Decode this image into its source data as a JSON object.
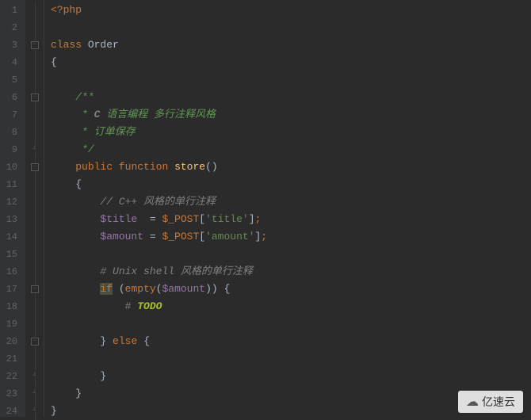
{
  "lines": [
    {
      "n": 1,
      "tokens": [
        {
          "t": "<?php",
          "c": "k-php"
        }
      ]
    },
    {
      "n": 2,
      "tokens": []
    },
    {
      "n": 3,
      "tokens": [
        {
          "t": "class",
          "c": "k-class"
        },
        {
          "t": " ",
          "c": ""
        },
        {
          "t": "Order",
          "c": "classname"
        }
      ]
    },
    {
      "n": 4,
      "tokens": [
        {
          "t": "{",
          "c": "brace"
        }
      ]
    },
    {
      "n": 5,
      "tokens": []
    },
    {
      "n": 6,
      "tokens": [
        {
          "t": "    ",
          "c": ""
        },
        {
          "t": "/**",
          "c": "doc-comment"
        }
      ]
    },
    {
      "n": 7,
      "tokens": [
        {
          "t": "     ",
          "c": ""
        },
        {
          "t": "* ",
          "c": "doc-comment"
        },
        {
          "t": "C",
          "c": "comment-bold"
        },
        {
          "t": " 语言编程 多行注释风格",
          "c": "doc-comment"
        }
      ]
    },
    {
      "n": 8,
      "tokens": [
        {
          "t": "     ",
          "c": ""
        },
        {
          "t": "* 订单保存",
          "c": "doc-comment"
        }
      ]
    },
    {
      "n": 9,
      "tokens": [
        {
          "t": "     ",
          "c": ""
        },
        {
          "t": "*/",
          "c": "doc-comment"
        }
      ]
    },
    {
      "n": 10,
      "tokens": [
        {
          "t": "    ",
          "c": ""
        },
        {
          "t": "public",
          "c": "k-public"
        },
        {
          "t": " ",
          "c": ""
        },
        {
          "t": "function",
          "c": "k-function"
        },
        {
          "t": " ",
          "c": ""
        },
        {
          "t": "store",
          "c": "funcname"
        },
        {
          "t": "()",
          "c": "paren"
        }
      ]
    },
    {
      "n": 11,
      "tokens": [
        {
          "t": "    ",
          "c": ""
        },
        {
          "t": "{",
          "c": "brace"
        }
      ]
    },
    {
      "n": 12,
      "tokens": [
        {
          "t": "        ",
          "c": ""
        },
        {
          "t": "// ",
          "c": "comment"
        },
        {
          "t": "C++",
          "c": "comment"
        },
        {
          "t": " 风格的单行注释",
          "c": "comment"
        }
      ]
    },
    {
      "n": 13,
      "tokens": [
        {
          "t": "        ",
          "c": ""
        },
        {
          "t": "$title",
          "c": "var"
        },
        {
          "t": "  = ",
          "c": "punct"
        },
        {
          "t": "$_POST",
          "c": "superglobal"
        },
        {
          "t": "[",
          "c": "punct"
        },
        {
          "t": "'title'",
          "c": "string"
        },
        {
          "t": "]",
          "c": "punct"
        },
        {
          "t": ";",
          "c": "semi"
        }
      ]
    },
    {
      "n": 14,
      "tokens": [
        {
          "t": "        ",
          "c": ""
        },
        {
          "t": "$amount",
          "c": "var"
        },
        {
          "t": " = ",
          "c": "punct"
        },
        {
          "t": "$_POST",
          "c": "superglobal"
        },
        {
          "t": "[",
          "c": "punct"
        },
        {
          "t": "'amount'",
          "c": "string"
        },
        {
          "t": "]",
          "c": "punct"
        },
        {
          "t": ";",
          "c": "semi"
        }
      ]
    },
    {
      "n": 15,
      "tokens": []
    },
    {
      "n": 16,
      "tokens": [
        {
          "t": "        ",
          "c": ""
        },
        {
          "t": "# Unix shell 风格的单行注释",
          "c": "comment"
        }
      ]
    },
    {
      "n": 17,
      "tokens": [
        {
          "t": "        ",
          "c": ""
        },
        {
          "t": "if",
          "c": "k-if"
        },
        {
          "t": " (",
          "c": "paren"
        },
        {
          "t": "empty",
          "c": "k-empty"
        },
        {
          "t": "(",
          "c": "paren"
        },
        {
          "t": "$amount",
          "c": "var"
        },
        {
          "t": ")) ",
          "c": "paren"
        },
        {
          "t": "{",
          "c": "brace"
        }
      ]
    },
    {
      "n": 18,
      "tokens": [
        {
          "t": "            ",
          "c": ""
        },
        {
          "t": "# ",
          "c": "hash"
        },
        {
          "t": "TODO",
          "c": "todo"
        }
      ]
    },
    {
      "n": 19,
      "tokens": []
    },
    {
      "n": 20,
      "tokens": [
        {
          "t": "        ",
          "c": ""
        },
        {
          "t": "}",
          "c": "brace"
        },
        {
          "t": " ",
          "c": ""
        },
        {
          "t": "else",
          "c": "k-else"
        },
        {
          "t": " ",
          "c": ""
        },
        {
          "t": "{",
          "c": "brace"
        }
      ]
    },
    {
      "n": 21,
      "tokens": []
    },
    {
      "n": 22,
      "tokens": [
        {
          "t": "        ",
          "c": ""
        },
        {
          "t": "}",
          "c": "brace"
        }
      ]
    },
    {
      "n": 23,
      "tokens": [
        {
          "t": "    ",
          "c": ""
        },
        {
          "t": "}",
          "c": "brace"
        }
      ]
    },
    {
      "n": 24,
      "tokens": [
        {
          "t": "}",
          "c": "brace"
        }
      ]
    }
  ],
  "fold_marks": {
    "3": "open",
    "6": "open",
    "9": "close",
    "10": "open",
    "17": "open",
    "20": "open",
    "22": "close",
    "23": "close",
    "24": "close"
  },
  "watermark": {
    "text": "亿速云",
    "icon": "☁"
  }
}
